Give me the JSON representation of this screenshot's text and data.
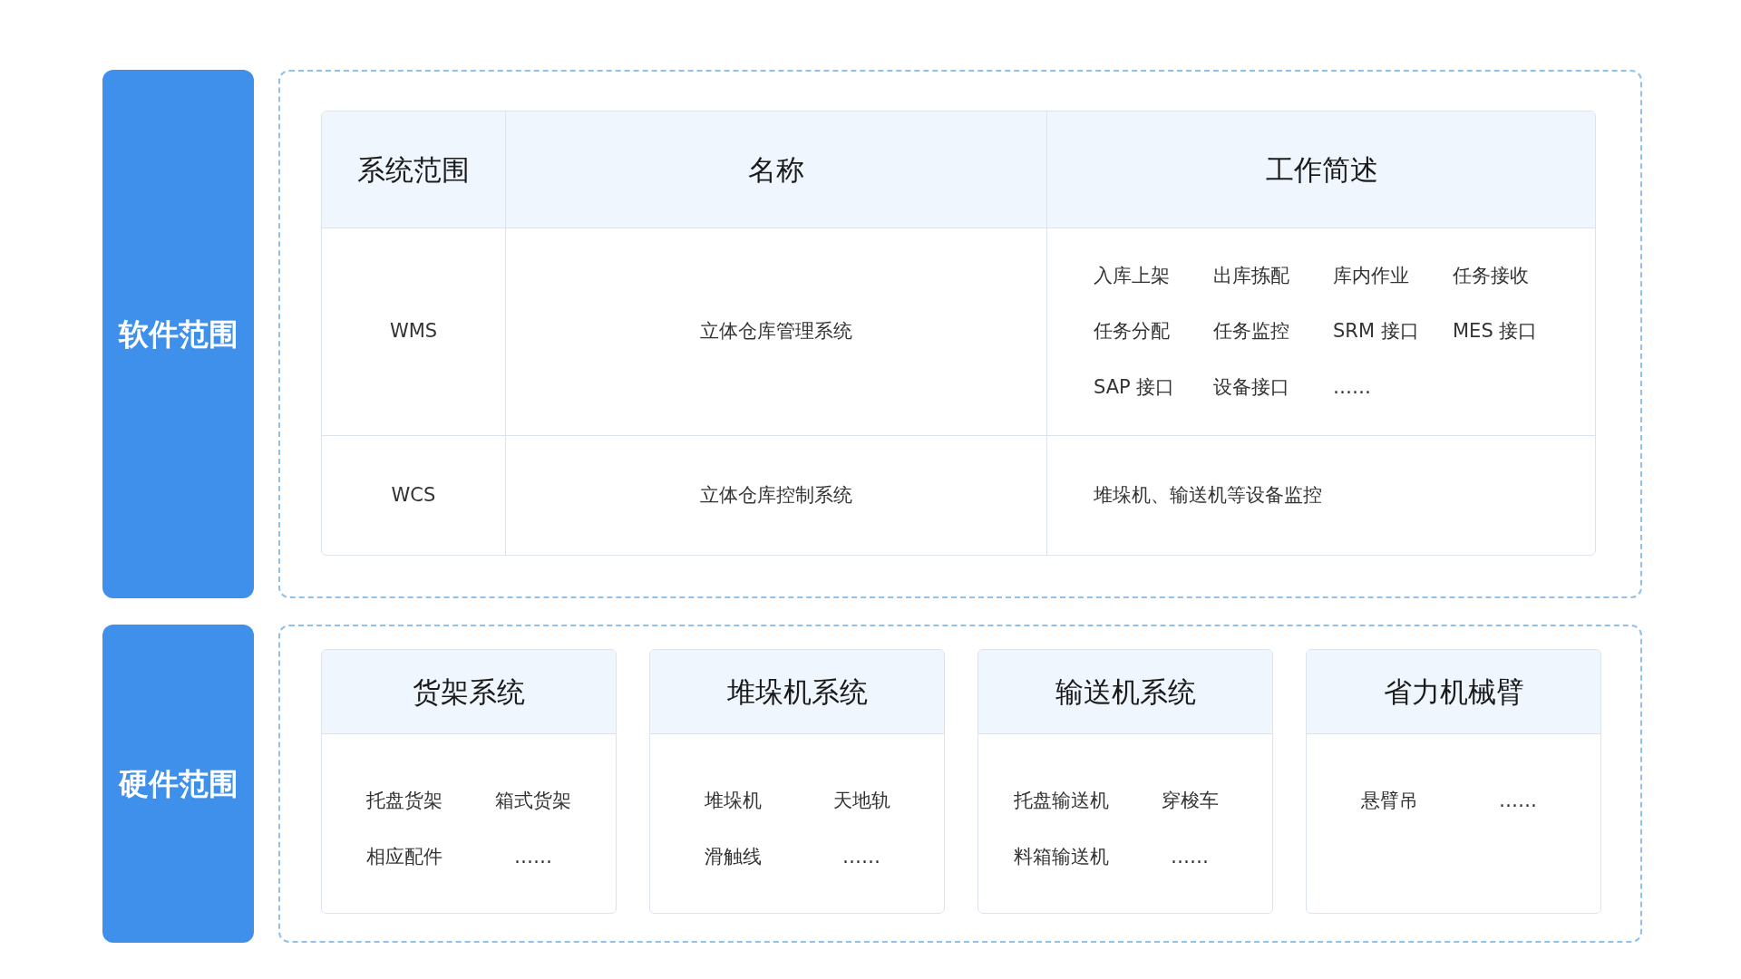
{
  "software": {
    "label": "软件范围",
    "table": {
      "columns": [
        "系统范围",
        "名称",
        "工作简述"
      ],
      "rows": [
        {
          "scope": "WMS",
          "name": "立体仓库管理系统",
          "work": {
            "kind": "items",
            "items": [
              "入库上架",
              "出库拣配",
              "库内作业",
              "任务接收",
              "任务分配",
              "任务监控",
              "SRM 接口",
              "MES 接口",
              "SAP 接口",
              "设备接口",
              "……"
            ]
          }
        },
        {
          "scope": "WCS",
          "name": "立体仓库控制系统",
          "work": {
            "kind": "text",
            "text": "堆垛机、输送机等设备监控"
          }
        }
      ]
    }
  },
  "hardware": {
    "label": "硬件范围",
    "cards": [
      {
        "title": "货架系统",
        "items": [
          "托盘货架",
          "箱式货架",
          "相应配件",
          "……"
        ]
      },
      {
        "title": "堆垛机系统",
        "items": [
          "堆垛机",
          "天地轨",
          "滑触线",
          "……"
        ]
      },
      {
        "title": "输送机系统",
        "items": [
          "托盘输送机",
          "穿梭车",
          "料箱输送机",
          "……"
        ]
      },
      {
        "title": "省力机械臂",
        "items": [
          "悬臂吊",
          "……"
        ]
      }
    ]
  }
}
